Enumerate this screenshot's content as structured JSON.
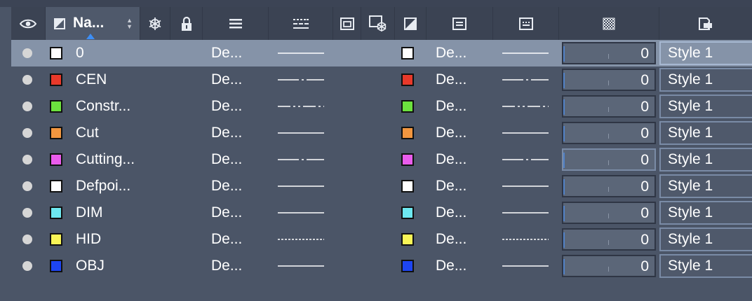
{
  "header": {
    "name_label": "Na...",
    "icons": [
      "eye-icon",
      "layer-color-icon",
      "freeze-icon",
      "lock-icon",
      "lineweight-icon",
      "linetype-icon",
      "viewport-icon",
      "viewport-freeze-icon",
      "vp-color-icon",
      "vp-linetype-icon",
      "vp-lineweight-icon",
      "transparency-icon",
      "plot-style-icon"
    ]
  },
  "rows": [
    {
      "name": "0",
      "color": "#ffffff",
      "lt": "De...",
      "line": "solid",
      "vp_color": "#ffffff",
      "vp_lt": "De...",
      "vp_line": "solid",
      "transparency": "0",
      "style": "Style 1"
    },
    {
      "name": "CEN",
      "color": "#e8392a",
      "lt": "De...",
      "line": "center",
      "vp_color": "#e8392a",
      "vp_lt": "De...",
      "vp_line": "center",
      "transparency": "0",
      "style": "Style 1"
    },
    {
      "name": "Constr...",
      "color": "#6ce23e",
      "lt": "De...",
      "line": "phantom",
      "vp_color": "#6ce23e",
      "vp_lt": "De...",
      "vp_line": "phantom",
      "transparency": "0",
      "style": "Style 1"
    },
    {
      "name": "Cut",
      "color": "#f2963f",
      "lt": "De...",
      "line": "solid",
      "vp_color": "#f2963f",
      "vp_lt": "De...",
      "vp_line": "solid",
      "transparency": "0",
      "style": "Style 1"
    },
    {
      "name": "Cutting...",
      "color": "#ea5ced",
      "lt": "De...",
      "line": "center",
      "vp_color": "#ea5ced",
      "vp_lt": "De...",
      "vp_line": "center",
      "transparency": "0",
      "style": "Style 1"
    },
    {
      "name": "Defpoi...",
      "color": "#ffffff",
      "lt": "De...",
      "line": "solid",
      "vp_color": "#ffffff",
      "vp_lt": "De...",
      "vp_line": "solid",
      "transparency": "0",
      "style": "Style 1"
    },
    {
      "name": "DIM",
      "color": "#6de8f0",
      "lt": "De...",
      "line": "solid",
      "vp_color": "#6de8f0",
      "vp_lt": "De...",
      "vp_line": "solid",
      "transparency": "0",
      "style": "Style 1"
    },
    {
      "name": "HID",
      "color": "#f9f557",
      "lt": "De...",
      "line": "dashed",
      "vp_color": "#f9f557",
      "vp_lt": "De...",
      "vp_line": "dashed",
      "transparency": "0",
      "style": "Style 1"
    },
    {
      "name": "OBJ",
      "color": "#1d45f2",
      "lt": "De...",
      "line": "solid",
      "vp_color": "#1d45f2",
      "vp_lt": "De...",
      "vp_line": "solid",
      "transparency": "0",
      "style": "Style 1"
    }
  ],
  "colors": {
    "selected_row": "#8593a8",
    "background": "#4b5567",
    "header": "#3b4353",
    "accent": "#3d8ef5"
  }
}
